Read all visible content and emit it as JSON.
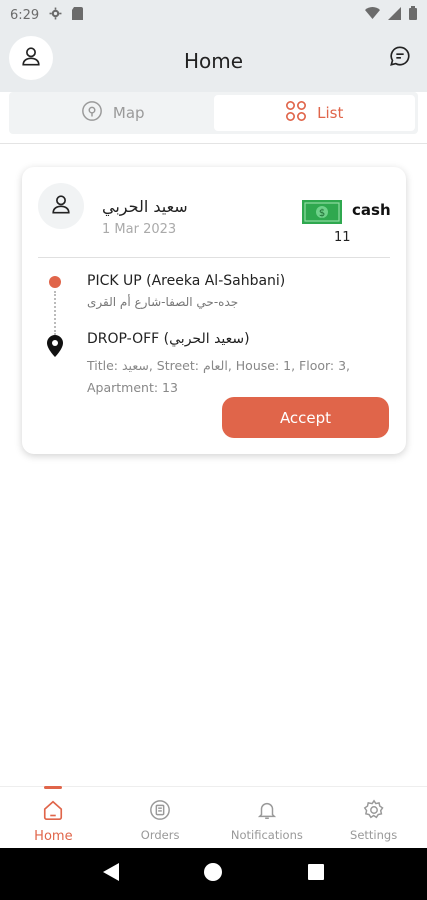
{
  "status_bar": {
    "time": "6:29"
  },
  "header": {
    "title": "Home"
  },
  "segment": {
    "map_label": "Map",
    "list_label": "List"
  },
  "order": {
    "customer_name": "سعيد الحربي",
    "date": "1 Mar 2023",
    "payment_method": "cash",
    "amount": "11",
    "pickup_title": "PICK UP (Areeka  Al-Sahbani)",
    "pickup_address": "جده-حي الصفا-شارع أم القرى",
    "dropoff_title": "DROP-OFF (سعيد الحربي)",
    "dropoff_details": "Title: سعيد, Street: العام, House: 1, Floor: 3, Apartment: 13",
    "accept_label": "Accept"
  },
  "bottom_nav": {
    "items": [
      {
        "label": "Home",
        "icon": "home-icon",
        "active": true
      },
      {
        "label": "Orders",
        "icon": "orders-icon",
        "active": false
      },
      {
        "label": "Notifications",
        "icon": "bell-icon",
        "active": false
      },
      {
        "label": "Settings",
        "icon": "gear-icon",
        "active": false
      }
    ]
  },
  "colors": {
    "accent": "#e0654a",
    "header_bg": "#e9ecee",
    "money_green": "#2fa84f"
  }
}
